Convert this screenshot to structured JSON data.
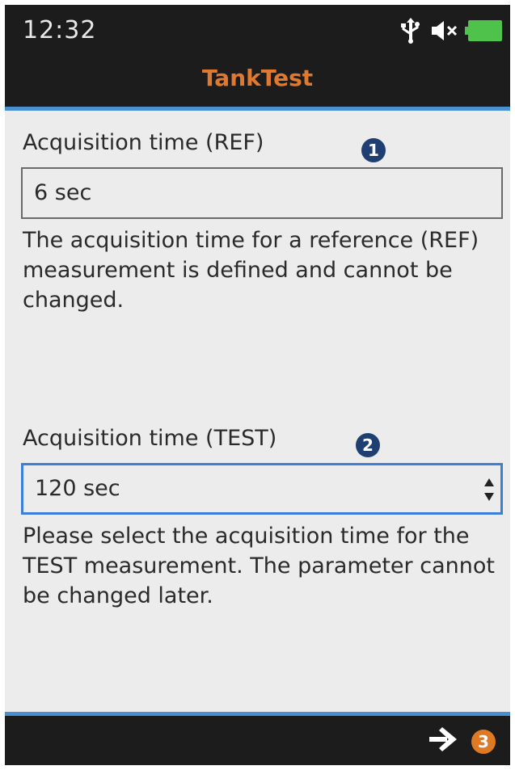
{
  "status_bar": {
    "time": "12:32",
    "icons": [
      "usb-icon",
      "mute-icon",
      "battery-icon"
    ],
    "battery_color": "#4ec24a"
  },
  "header": {
    "title": "TankTest",
    "title_color": "#e0782e",
    "accent_color": "#4a8fd1"
  },
  "ref": {
    "label": "Acquisition time (REF)",
    "badge": "1",
    "value": "6 sec",
    "description": "The acquisition time for a reference (REF) measurement is defined and cannot be changed."
  },
  "test": {
    "label": "Acquisition time (TEST)",
    "badge": "2",
    "selected": "120 sec",
    "description": "Please select the acquisition time for the TEST measurement. The parameter cannot be changed later."
  },
  "footer": {
    "next_icon": "arrow-right-icon",
    "badge": "3"
  }
}
